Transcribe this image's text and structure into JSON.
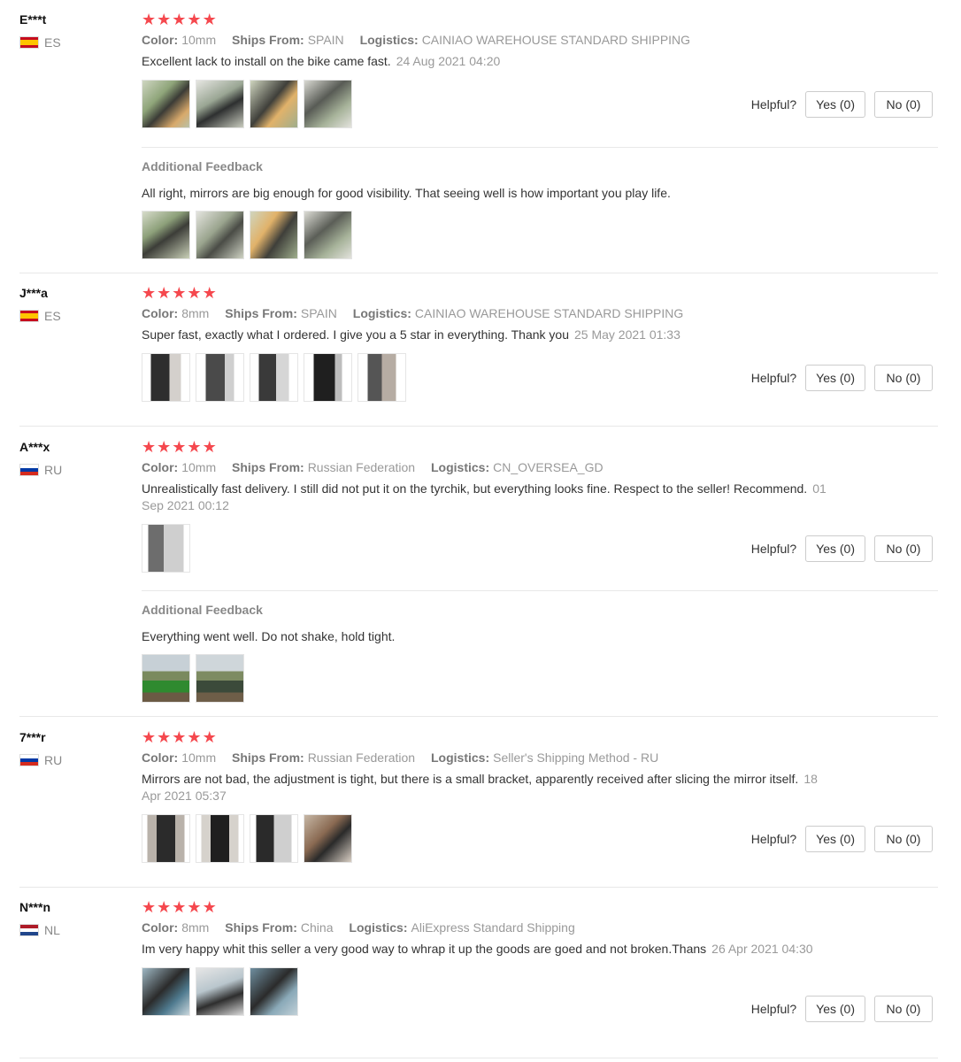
{
  "labels": {
    "color": "Color:",
    "ships_from": "Ships From:",
    "logistics": "Logistics:",
    "helpful": "Helpful?",
    "additional_feedback": "Additional Feedback"
  },
  "reviews": [
    {
      "user": "E***t",
      "country": "ES",
      "rating": 5,
      "color": "10mm",
      "ships_from": "SPAIN",
      "logistics": "CAINIAO WAREHOUSE STANDARD SHIPPING",
      "text": "Excellent lack to install on the bike came fast.",
      "date": "24 Aug 2021 04:20",
      "yes": "Yes (0)",
      "no": "No (0)",
      "additional_text": "All right, mirrors are big enough for good visibility. That seeing well is how important you play life."
    },
    {
      "user": "J***a",
      "country": "ES",
      "rating": 5,
      "color": "8mm",
      "ships_from": "SPAIN",
      "logistics": "CAINIAO WAREHOUSE STANDARD SHIPPING",
      "text": "Super fast, exactly what I ordered. I give you a 5 star in everything. Thank you",
      "date": "25 May 2021 01:33",
      "yes": "Yes (0)",
      "no": "No (0)"
    },
    {
      "user": "A***x",
      "country": "RU",
      "rating": 5,
      "color": "10mm",
      "ships_from": "Russian Federation",
      "logistics": "CN_OVERSEA_GD",
      "text": "Unrealistically fast delivery. I still did not put it on the tyrchik, but everything looks fine. Respect to the seller! Recommend.",
      "date": "01 Sep 2021 00:12",
      "yes": "Yes (0)",
      "no": "No (0)",
      "additional_text": "Everything went well. Do not shake, hold tight."
    },
    {
      "user": "7***r",
      "country": "RU",
      "rating": 5,
      "color": "10mm",
      "ships_from": "Russian Federation",
      "logistics": "Seller's Shipping Method - RU",
      "text": "Mirrors are not bad, the adjustment is tight, but there is a small bracket, apparently received after slicing the mirror itself.",
      "date": "18 Apr 2021 05:37",
      "yes": "Yes (0)",
      "no": "No (0)"
    },
    {
      "user": "N***n",
      "country": "NL",
      "rating": 5,
      "color": "8mm",
      "ships_from": "China",
      "logistics": "AliExpress Standard Shipping",
      "text": "Im very happy whit this seller a very good way to whrap it up the goods are goed and not broken.Thans",
      "date": "26 Apr 2021 04:30",
      "yes": "Yes (0)",
      "no": "No (0)"
    }
  ],
  "colors": {
    "star": "#f5484e",
    "muted": "#999999",
    "border": "#e8e8e8"
  }
}
